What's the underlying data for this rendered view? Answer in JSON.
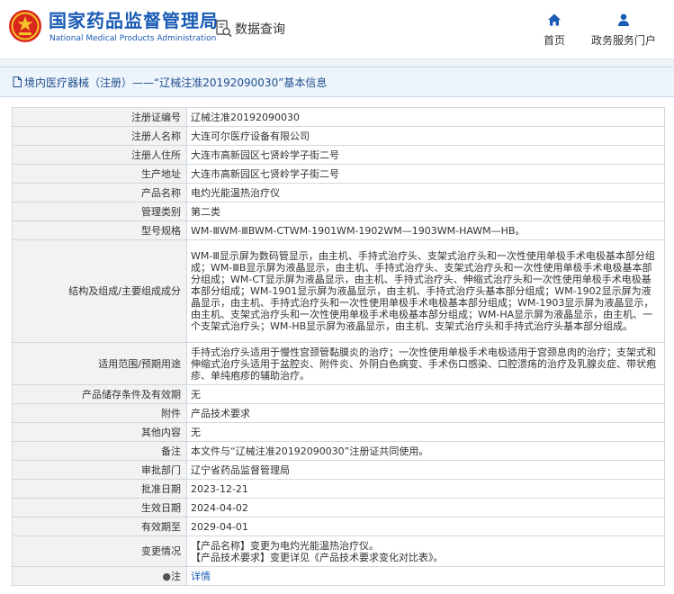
{
  "header": {
    "title": "国家药品监督管理局",
    "subtitle": "National Medical Products Administration",
    "query_label": "数据查询",
    "nav": [
      {
        "label": "首页",
        "icon": "home-icon"
      },
      {
        "label": "政务服务门户",
        "icon": "user-icon"
      }
    ]
  },
  "breadcrumb": {
    "text": "境内医疗器械（注册）——“辽械注准20192090030”基本信息"
  },
  "rows": [
    {
      "label": "注册证编号",
      "value": "辽械注准20192090030"
    },
    {
      "label": "注册人名称",
      "value": "大连可尔医疗设备有限公司"
    },
    {
      "label": "注册人住所",
      "value": "大连市高新园区七贤岭学子街二号"
    },
    {
      "label": "生产地址",
      "value": "大连市高新园区七贤岭学子街二号"
    },
    {
      "label": "产品名称",
      "value": "电灼光能温热治疗仪"
    },
    {
      "label": "管理类别",
      "value": "第二类"
    },
    {
      "label": "型号规格",
      "value": "WM-ⅢWM-ⅢBWM-CTWM-1901WM-1902WM—1903WM-HAWM—HB。"
    },
    {
      "label": "结构及组成/主要组成成分",
      "value": "WM-Ⅲ显示屏为数码管显示，由主机、手持式治疗头、支架式治疗头和一次性使用单极手术电极基本部分组成；WM-ⅢB显示屏为液晶显示，由主机、手持式治疗头、支架式治疗头和一次性使用单极手术电极基本部分组成；WM-CT显示屏为液晶显示，由主机、手持式治疗头、伸缩式治疗头和一次性使用单极手术电极基本部分组成；WM-1901显示屏为液晶显示，由主机、手持式治疗头基本部分组成；WM-1902显示屏为液晶显示，由主机、手持式治疗头和一次性使用单极手术电极基本部分组成；WM-1903显示屏为液晶显示，由主机、支架式治疗头和一次性使用单极手术电极基本部分组成；WM-HA显示屏为液晶显示，由主机、一个支架式治疗头；WM-HB显示屏为液晶显示，由主机、支架式治疗头和手持式治疗头基本部分组成。"
    },
    {
      "label": "适用范围/预期用途",
      "value": "手持式治疗头适用于慢性宫颈管黏膜炎的治疗；一次性使用单极手术电极适用于宫颈息肉的治疗；支架式和伸缩式治疗头适用于盆腔炎、附件炎、外阴白色病变、手术伤口感染、口腔溃疡的治疗及乳腺炎症、带状疱疹、单纯疱疹的辅助治疗。"
    },
    {
      "label": "产品储存条件及有效期",
      "value": "无"
    },
    {
      "label": "附件",
      "value": "产品技术要求"
    },
    {
      "label": "其他内容",
      "value": "无"
    },
    {
      "label": "备注",
      "value": "本文件与“辽械注准20192090030”注册证共同使用。"
    },
    {
      "label": "审批部门",
      "value": "辽宁省药品监督管理局"
    },
    {
      "label": "批准日期",
      "value": "2023-12-21"
    },
    {
      "label": "生效日期",
      "value": "2024-04-02"
    },
    {
      "label": "有效期至",
      "value": "2029-04-01"
    }
  ],
  "change_row": {
    "label": "变更情况",
    "lines": [
      "【产品名称】变更为电灼光能温热治疗仪。",
      "【产品技术要求】变更详见《产品技术要求变化对比表》。"
    ]
  },
  "note_row": {
    "bulb": "●",
    "label": "注",
    "link": "详情"
  },
  "colors": {
    "brand_blue": "#1a5bb5",
    "label_bg": "#f2f2f2",
    "border": "#cfd8e3",
    "breadcrumb_bg": "#eef4fb"
  }
}
